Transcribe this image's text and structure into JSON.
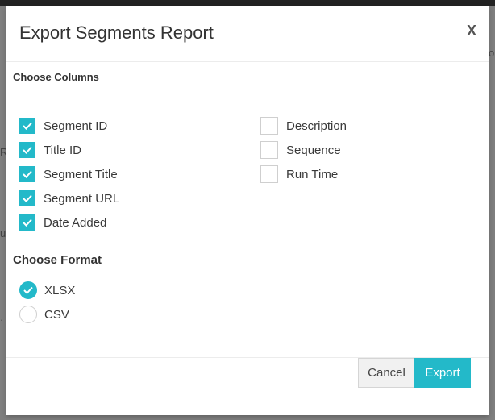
{
  "modal": {
    "title": "Export Segments Report",
    "close_label": "X"
  },
  "columns_section": {
    "label": "Choose Columns",
    "left_items": [
      {
        "label": "Segment ID",
        "checked": true
      },
      {
        "label": "Title ID",
        "checked": true
      },
      {
        "label": "Segment Title",
        "checked": true
      },
      {
        "label": "Segment URL",
        "checked": true
      },
      {
        "label": "Date Added",
        "checked": true
      }
    ],
    "right_items": [
      {
        "label": "Description",
        "checked": false
      },
      {
        "label": "Sequence",
        "checked": false
      },
      {
        "label": "Run Time",
        "checked": false
      }
    ]
  },
  "format_section": {
    "label": "Choose Format",
    "options": [
      {
        "label": "XLSX",
        "selected": true
      },
      {
        "label": "CSV",
        "selected": false
      }
    ]
  },
  "footer": {
    "cancel_label": "Cancel",
    "export_label": "Export"
  },
  "colors": {
    "accent": "#23b9c9"
  }
}
